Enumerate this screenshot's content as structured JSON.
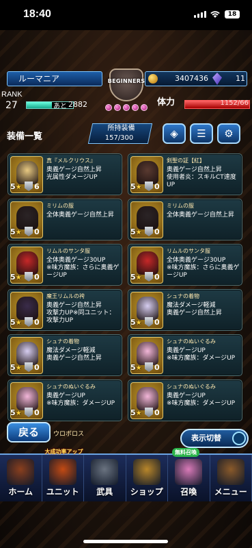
{
  "status_bar": {
    "time": "18:40",
    "battery": "18"
  },
  "hud": {
    "player_name": "ルーマニア",
    "emblem_text": "BEGINNERS",
    "gold": "3407436",
    "stones": "11",
    "rank_label": "RANK",
    "rank": "27",
    "exp_prefix": "あと",
    "exp_remaining": "2882",
    "stamina_label": "体力",
    "stamina": "1152/66"
  },
  "equip_header": {
    "title": "装備一覧",
    "owned_label": "所持装備",
    "owned_count": "157/300"
  },
  "items": [
    {
      "name": "真『メルクリウス』",
      "desc": "奥義ゲージ自然上昇\n光属性ダメージUP",
      "stars": "5",
      "plus": "6",
      "thumb": "#e8c982"
    },
    {
      "name": "剣聖の証【紅】",
      "desc": "奥義ゲージ自然上昇\n使用者炎：スキルCT速度UP",
      "stars": "5",
      "plus": "0",
      "thumb": "#5a3a30"
    },
    {
      "name": "ミリムの服",
      "desc": "全体奥義ゲージ自然上昇",
      "stars": "5",
      "plus": "0",
      "thumb": "#2b2426"
    },
    {
      "name": "ミリムの服",
      "desc": "全体奥義ゲージ自然上昇",
      "stars": "5",
      "plus": "0",
      "thumb": "#2b2426"
    },
    {
      "name": "リムルのサンタ服",
      "desc": "全体奥義ゲージ30UP\n※味方魔族：さらに奥義ゲージUP",
      "stars": "5",
      "plus": "0",
      "thumb": "#c62828"
    },
    {
      "name": "リムルのサンタ服",
      "desc": "全体奥義ゲージ30UP\n※味方魔族：さらに奥義ゲージUP",
      "stars": "5",
      "plus": "0",
      "thumb": "#c62828"
    },
    {
      "name": "魔王リムルの袴",
      "desc": "奥義ゲージ自然上昇\n攻撃力UP※同ユニット：攻撃力UP",
      "stars": "5",
      "plus": "0",
      "thumb": "#3a2c4a"
    },
    {
      "name": "シュナの着物",
      "desc": "魔法ダメージ軽減\n奥義ゲージ自然上昇",
      "stars": "5",
      "plus": "0",
      "thumb": "#d6cdf0"
    },
    {
      "name": "シュナの着物",
      "desc": "魔法ダメージ軽減\n奥義ゲージ自然上昇",
      "stars": "5",
      "plus": "0",
      "thumb": "#d6cdf0"
    },
    {
      "name": "シュナのぬいぐるみ",
      "desc": "奥義ゲージUP\n※味方魔族：ダメージUP",
      "stars": "5",
      "plus": "0",
      "thumb": "#f2b6d8"
    },
    {
      "name": "シュナのぬいぐるみ",
      "desc": "奥義ゲージUP\n※味方魔族：ダメージUP",
      "stars": "5",
      "plus": "0",
      "thumb": "#f2b6d8"
    },
    {
      "name": "シュナのぬいぐるみ",
      "desc": "奥義ゲージUP\n※味方魔族：ダメージUP",
      "stars": "5",
      "plus": "0",
      "thumb": "#f2b6d8"
    }
  ],
  "bottom_bar": {
    "back_label": "戻る",
    "peek_item": "ウロボロス",
    "toggle_label": "表示切替"
  },
  "nav": {
    "items": [
      {
        "label": "ホーム",
        "tag": "",
        "color": "#8a3f1e"
      },
      {
        "label": "ユニット",
        "tag": "大成功率アップ",
        "color": "#c24a14"
      },
      {
        "label": "武具",
        "tag": "",
        "color": "#6a7380"
      },
      {
        "label": "ショップ",
        "tag": "",
        "color": "#b8862a"
      },
      {
        "label": "召喚",
        "tag": "無料召喚",
        "color": "#d97ab8"
      },
      {
        "label": "メニュー",
        "tag": "",
        "color": "#8a5a2a"
      }
    ]
  }
}
